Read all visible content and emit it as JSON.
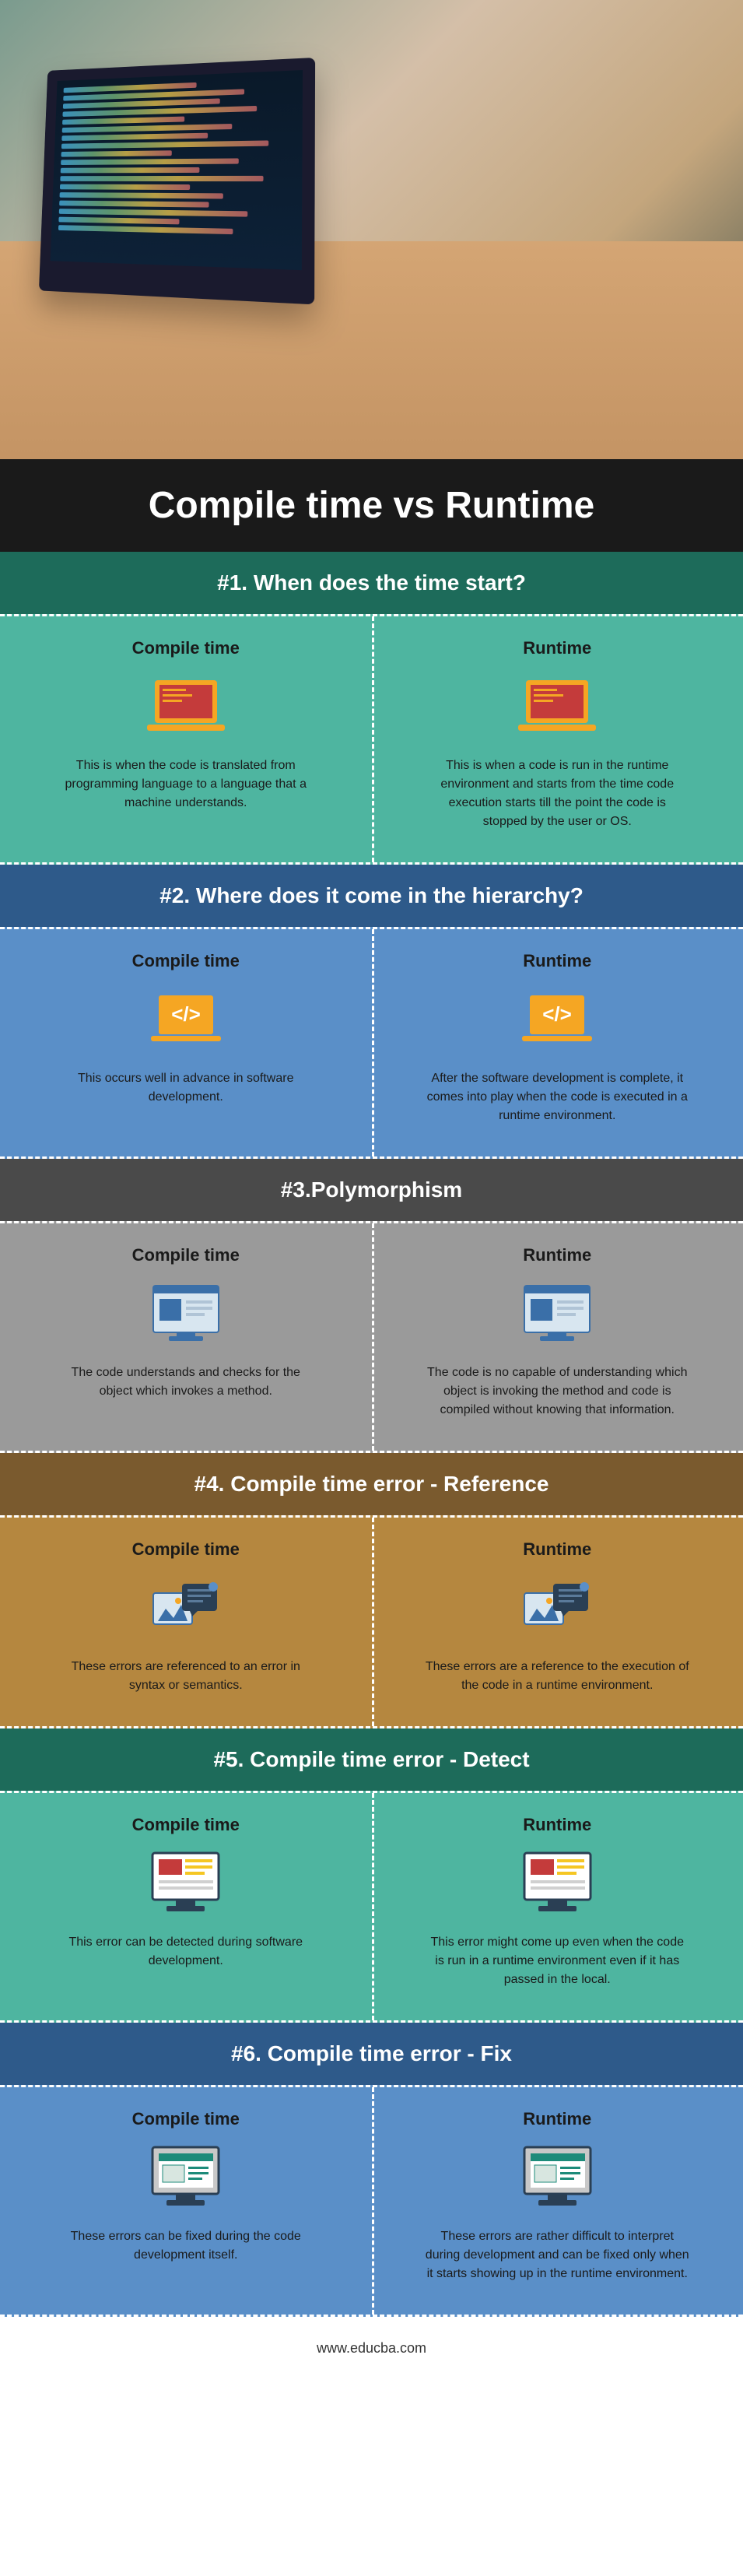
{
  "title": "Compile time vs Runtime",
  "footer": "www.educba.com",
  "sections": [
    {
      "header": "#1. When does the time start?",
      "left_title": "Compile time",
      "right_title": "Runtime",
      "left_text": "This is when the code is translated from programming language to a language that a machine understands.",
      "right_text": "This is when a code is run in the runtime environment and starts from the time code execution starts till the point the code is stopped by the user or OS."
    },
    {
      "header": "#2. Where does it come in the hierarchy?",
      "left_title": "Compile time",
      "right_title": "Runtime",
      "left_text": "This occurs well in advance in software development.",
      "right_text": "After the software development is complete, it comes into play when the code is executed in a runtime environment."
    },
    {
      "header": "#3.Polymorphism",
      "left_title": "Compile time",
      "right_title": "Runtime",
      "left_text": "The code understands and checks for the object which invokes a method.",
      "right_text": "The code is no capable of understanding which object is invoking the method and code is compiled without knowing that information."
    },
    {
      "header": "#4. Compile time error - Reference",
      "left_title": "Compile time",
      "right_title": "Runtime",
      "left_text": "These errors are referenced to an error in syntax or semantics.",
      "right_text": "These errors are a reference to the execution of the code in a runtime environment."
    },
    {
      "header": "#5. Compile time error - Detect",
      "left_title": "Compile time",
      "right_title": "Runtime",
      "left_text": "This error can be detected during software development.",
      "right_text": "This error might come up even when the code is run in a runtime environment even if it has passed in the local."
    },
    {
      "header": "#6. Compile time error - Fix",
      "left_title": "Compile time",
      "right_title": "Runtime",
      "left_text": "These errors can be fixed during the code development itself.",
      "right_text": "These errors are rather difficult to interpret during development and can be fixed only when it starts showing up in the runtime environment."
    }
  ]
}
